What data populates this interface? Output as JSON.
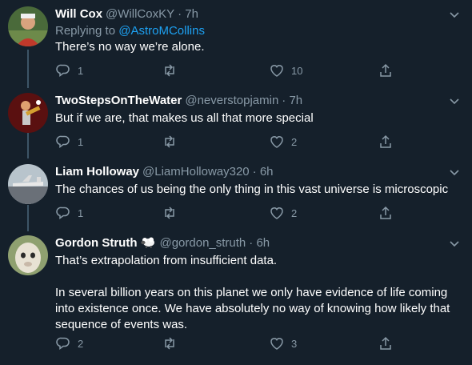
{
  "tweets": [
    {
      "name": "Will Cox",
      "handle": "@WillCoxKY",
      "time": "· 7h",
      "replying_prefix": "Replying to ",
      "replying_to": "@AstroMCollins",
      "text": [
        "There’s no way we’re alone."
      ],
      "replies": "1",
      "retweets": "",
      "likes": "10"
    },
    {
      "name": "TwoStepsOnTheWater",
      "handle": "@neverstopjamin",
      "time": "· 7h",
      "text": [
        "But if we are, that makes us all that more special"
      ],
      "replies": "1",
      "retweets": "",
      "likes": "2"
    },
    {
      "name": "Liam Holloway",
      "handle": "@LiamHolloway320",
      "time": "· 6h",
      "text": [
        "The chances of us being the only thing in this vast universe is microscopic"
      ],
      "replies": "1",
      "retweets": "",
      "likes": "2"
    },
    {
      "name": "Gordon Struth",
      "handle": "@gordon_struth",
      "time": "· 6h",
      "text": [
        "That’s extrapolation from insufficient data.",
        "In several billion years on this planet we only have evidence of life coming into existence once. We have absolutely no way of knowing how likely that sequence of events was."
      ],
      "replies": "2",
      "retweets": "",
      "likes": "3"
    }
  ],
  "icons": {
    "reply": "reply-icon",
    "retweet": "retweet-icon",
    "like": "heart-icon",
    "share": "share-icon",
    "caret": "chevron-down-icon",
    "emoji": "sheep-emoji-icon"
  },
  "colors": {
    "background": "#15202b",
    "secondary_text": "#8899a6",
    "link": "#1da1f2",
    "divider": "#38444d"
  }
}
